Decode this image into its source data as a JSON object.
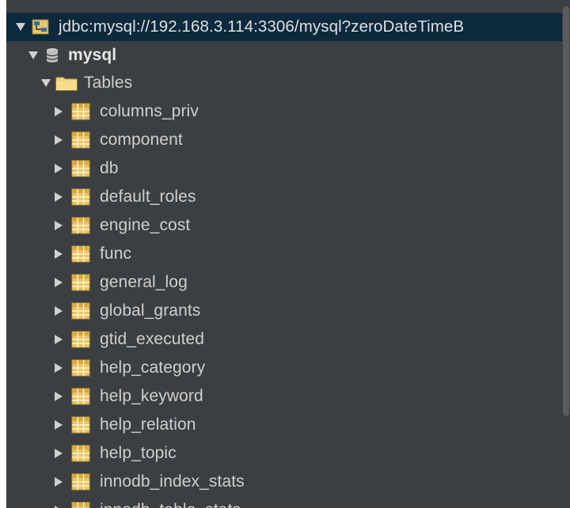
{
  "tree": {
    "connection": {
      "label": "jdbc:mysql://192.168.3.114:3306/mysql?zeroDateTimeB",
      "icon": "database-connection-icon",
      "expanded": true,
      "selected": true
    },
    "schema": {
      "label": "mysql",
      "icon": "database-schema-icon",
      "expanded": true
    },
    "folder": {
      "label": "Tables",
      "icon": "folder-icon",
      "expanded": true
    },
    "tables": [
      "columns_priv",
      "component",
      "db",
      "default_roles",
      "engine_cost",
      "func",
      "general_log",
      "global_grants",
      "gtid_executed",
      "help_category",
      "help_keyword",
      "help_relation",
      "help_topic",
      "innodb_index_stats",
      "innodb_table_stats"
    ]
  },
  "colors": {
    "background": "#3c3f41",
    "selection": "#0d293e",
    "text": "#cfcfcf",
    "table_icon": "#e8c46a",
    "folder_icon": "#f2d27a"
  }
}
